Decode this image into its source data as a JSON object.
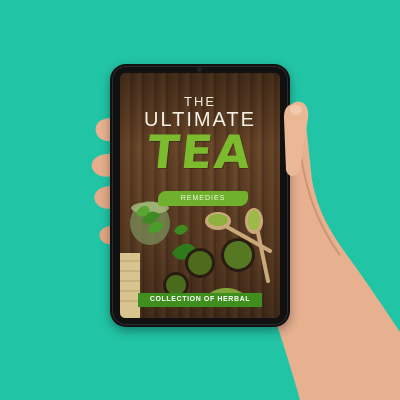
{
  "cover": {
    "line1": "THE",
    "line2": "ULTIMATE",
    "line3": "TEA",
    "subtitle": "REMEDIES",
    "banner": "COLLECTION OF HERBAL"
  },
  "colors": {
    "background": "#22c4a6",
    "tea_green": "#7dbb2e",
    "banner_green": "#3f8f1f",
    "tablet_bezel": "#111111",
    "wood": "#6b4729"
  },
  "icons": [
    "hand",
    "tablet-device",
    "tea-cup",
    "tea-leaf",
    "wooden-spoon",
    "matcha-bowl",
    "bamboo-mat"
  ]
}
